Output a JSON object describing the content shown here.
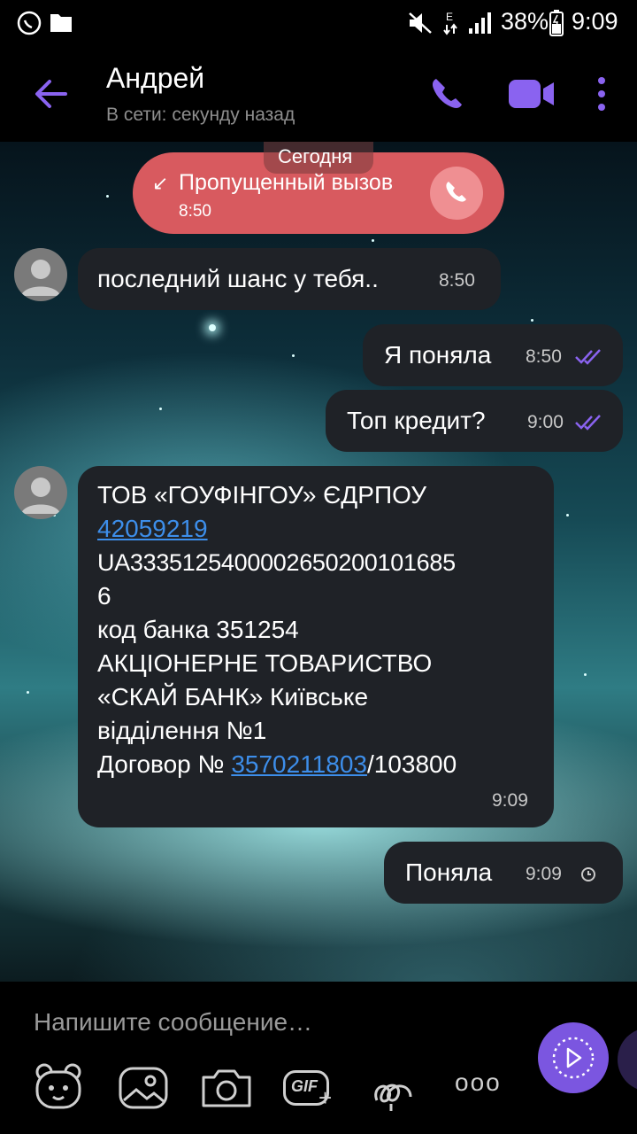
{
  "status_bar": {
    "battery": "38%",
    "time": "9:09"
  },
  "header": {
    "contact_name": "Андрей",
    "contact_status": "В сети: секунду назад"
  },
  "chat": {
    "date_divider": "Сегодня",
    "missed_call": {
      "label": "Пропущенный вызов",
      "time": "8:50"
    },
    "messages": [
      {
        "text": "последний шанс у тебя..",
        "time": "8:50"
      },
      {
        "text": "Я поняла",
        "time": "8:50"
      },
      {
        "text": "Топ кредит?",
        "time": "9:00"
      },
      {
        "line1": "ТОВ «ГОУФІНГОУ» ЄДРПОУ",
        "link1": "42059219",
        "line2": "UA3335125400002650200101685",
        "line3": "6",
        "line4": "код банка 351254",
        "line5": "АКЦІОНЕРНЕ ТОВАРИСТВО",
        "line6": "«СКАЙ БАНК» Київське",
        "line7": "відділення №1",
        "line8_prefix": "Договор № ",
        "link2": "3570211803",
        "line8_suffix": "/103800",
        "time": "9:09"
      },
      {
        "text": "Поняла",
        "time": "9:09"
      }
    ]
  },
  "composer": {
    "placeholder": "Напишите сообщение…",
    "gif_label": "GIF",
    "more_label": "ooo"
  },
  "colors": {
    "accent": "#7b56e0",
    "missed_call_bg": "#d85a5f",
    "bubble_bg": "#1f2227",
    "link": "#3d8eea"
  }
}
